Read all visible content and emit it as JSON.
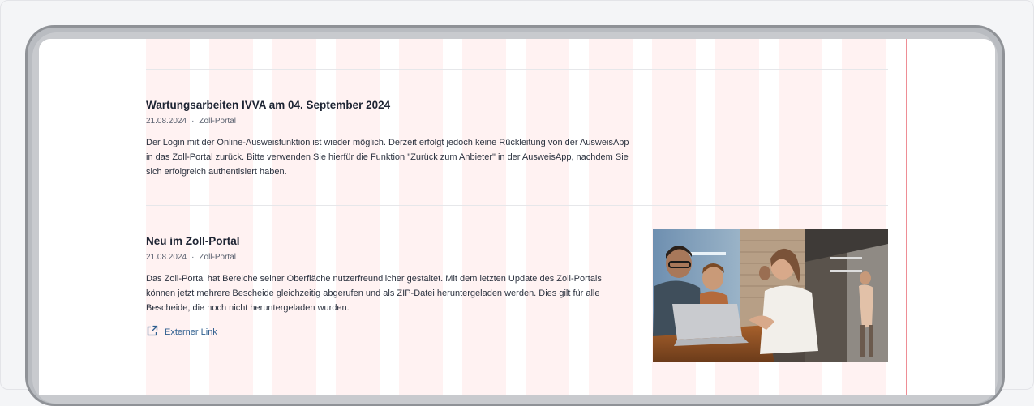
{
  "news": [
    {
      "title": "Wartungsarbeiten IVVA am 04. September 2024",
      "date": "21.08.2024",
      "category": "Zoll-Portal",
      "body": "Der Login mit der Online-Ausweisfunktion ist wieder möglich. Derzeit erfolgt jedoch keine Rückleitung von der AusweisApp in das Zoll-Portal zurück. Bitte verwenden Sie hierfür die Funktion \"Zurück zum Anbieter\" in der AusweisApp, nachdem Sie sich erfolgreich authentisiert haben."
    },
    {
      "title": "Neu im Zoll-Portal",
      "date": "21.08.2024",
      "category": "Zoll-Portal",
      "body": "Das Zoll-Portal hat Bereiche seiner Oberfläche nutzerfreundlicher gestaltet. Mit dem letzten Update des Zoll-Portals können jetzt mehrere Bescheide gleichzeitig abgerufen und als ZIP-Datei heruntergeladen werden. Dies gilt für alle Bescheide, die noch nicht heruntergeladen wurden.",
      "link_label": "Externer Link",
      "link_icon": "external-link-icon",
      "image": "team-at-laptop-photo"
    }
  ],
  "meta_separator": "·",
  "colors": {
    "grid_line": "#ee8d95",
    "grid_column": "#fff2f2",
    "title": "#1d2433",
    "link": "#2f5f8f"
  }
}
